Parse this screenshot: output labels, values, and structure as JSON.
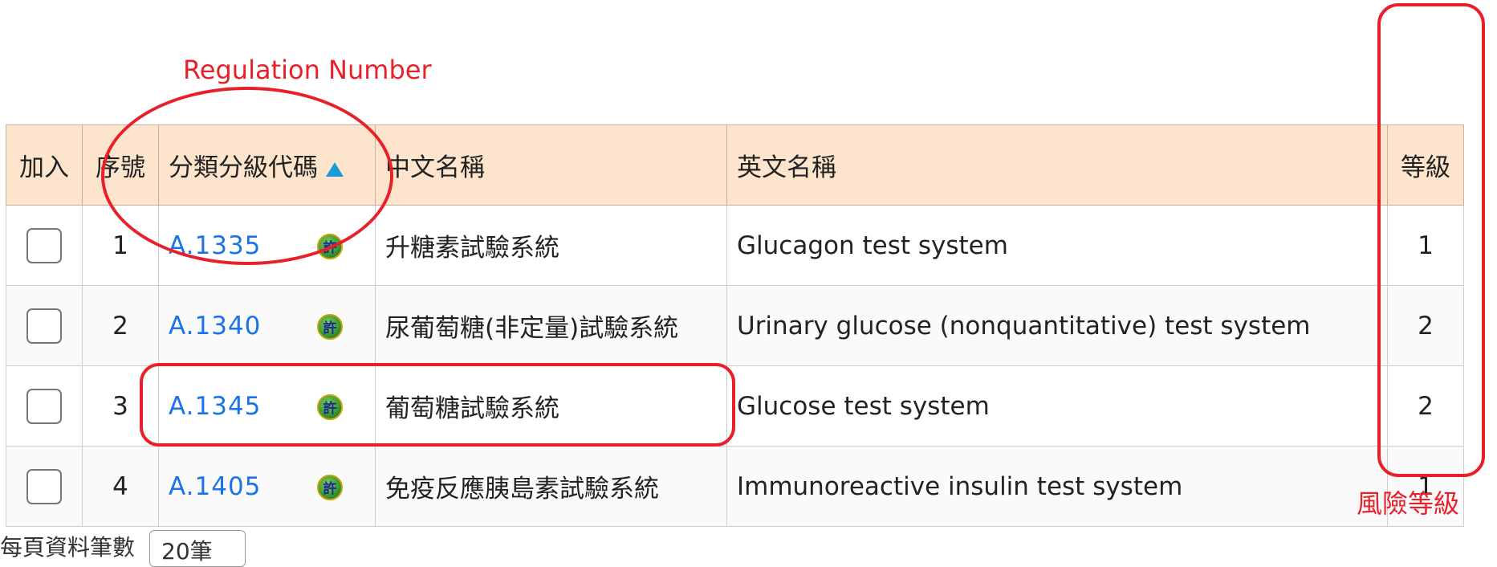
{
  "table": {
    "headers": {
      "add": "加入",
      "seq": "序號",
      "code": "分類分級代碼",
      "cn_name": "中文名稱",
      "en_name": "英文名稱",
      "level": "等級"
    },
    "rows": [
      {
        "seq": "1",
        "code": "A.1335",
        "cn": "升糖素試驗系統",
        "en": "Glucagon test system",
        "level": "1",
        "icon": "許"
      },
      {
        "seq": "2",
        "code": "A.1340",
        "cn": "尿葡萄糖(非定量)試驗系統",
        "en": "Urinary glucose (nonquantitative) test system",
        "level": "2",
        "icon": "許"
      },
      {
        "seq": "3",
        "code": "A.1345",
        "cn": "葡萄糖試驗系統",
        "en": "Glucose test system",
        "level": "2",
        "icon": "許"
      },
      {
        "seq": "4",
        "code": "A.1405",
        "cn": "免疫反應胰島素試驗系統",
        "en": "Immunoreactive insulin test system",
        "level": "1",
        "icon": "許"
      }
    ]
  },
  "annotations": {
    "regulation_number": "Regulation Number",
    "risk_level": "風險等級"
  },
  "footer": {
    "per_page_label": "每頁資料筆數",
    "per_page_value": "20筆"
  },
  "colors": {
    "header_bg": "#fde4cc",
    "link": "#1a73e8",
    "annotation": "#e8202a",
    "sort_arrow": "#1a9bd7"
  }
}
